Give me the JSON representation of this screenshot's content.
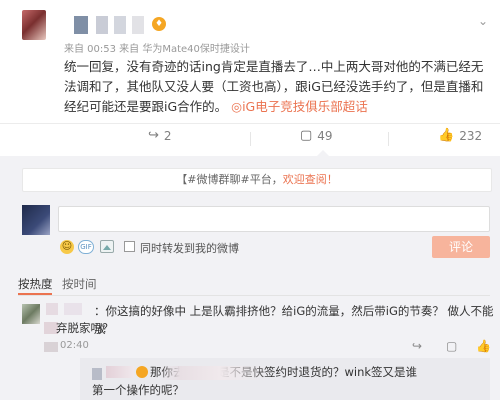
{
  "post": {
    "meta": "来自 00:53 来自 华为Mate40保时捷设计",
    "vip_badge": "♦",
    "text_main": "统一回复，没有奇迹的话ing肯定是直播去了…中上两大哥对他的不满已经无法调和了，其他队又没人要（工资也高），跟iG已经没选手约了，但是直播和经纪可能还是要跟iG合作的。",
    "link": "◎iG电子竞技俱乐部超话",
    "forward_count": "2",
    "comment_count": "49",
    "like_count": "232"
  },
  "icons": {
    "chevron": "⌄",
    "forward": "↪",
    "comment": "▢",
    "like": "👍"
  },
  "comments_panel": {
    "notice_prefix": "【#微博群聊#平台，",
    "notice_highlight": "欢迎查阅！",
    "input_placeholder": "",
    "repost_label": "同时转发到我的微博",
    "post_button": "评论",
    "gif_label": "GIF",
    "emoji": "☺",
    "tab_hot": "按热度",
    "tab_time": "按时间"
  },
  "comments": [
    {
      "text": "：你这搞的好像中 上是队霸排挤他？给iG的流量，然后带iG的节奏？ 做人不能放",
      "text2": "弃脱家吗？",
      "time": "02:40",
      "forward": "↪",
      "comment": "▢",
      "like": "👍"
    }
  ],
  "reply": {
    "text": "那你去问问ig是不是快签约时退货的？wink签又是谁",
    "text2": "第一个操作的呢？"
  }
}
